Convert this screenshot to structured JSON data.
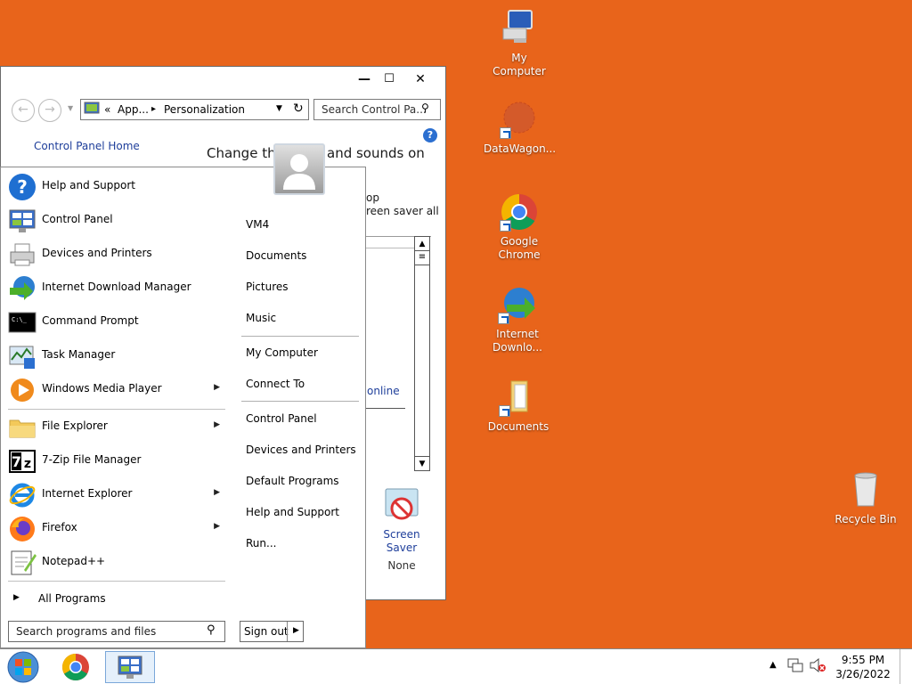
{
  "desktop": {
    "background": "#e8641b",
    "icons": [
      {
        "label": "My Computer",
        "icon": "computer-icon"
      },
      {
        "label": "DataWagon...",
        "icon": "datawagon-icon"
      },
      {
        "label": "Google Chrome",
        "icon": "chrome-icon"
      },
      {
        "label": "Internet Downlo...",
        "icon": "idm-icon"
      },
      {
        "label": "Documents",
        "icon": "folder-icon"
      },
      {
        "label": "Recycle Bin",
        "icon": "recycle-bin-icon"
      }
    ]
  },
  "window": {
    "minimize": "—",
    "maximize": "☐",
    "close": "✕",
    "breadcrumb_prefix": "«",
    "breadcrumb_app": "App...",
    "breadcrumb_sep": "▸",
    "breadcrumb_current": "Personalization",
    "search_placeholder": "Search Control Pa...",
    "control_panel_home": "Control Panel Home",
    "heading_left": "Change the",
    "heading_right": "and sounds on",
    "frag_op": "op",
    "frag_screensaver": "reen saver all",
    "frag_online": "online",
    "screen_saver_label_1": "Screen",
    "screen_saver_label_2": "Saver",
    "screen_saver_value": "None"
  },
  "start_menu": {
    "left_items": [
      {
        "label": "Help and Support",
        "icon": "help-icon",
        "arrow": false
      },
      {
        "label": "Control Panel",
        "icon": "control-panel-icon",
        "arrow": false
      },
      {
        "label": "Devices and Printers",
        "icon": "printer-icon",
        "arrow": false
      },
      {
        "label": "Internet Download Manager",
        "icon": "idm-icon",
        "arrow": false
      },
      {
        "label": "Command Prompt",
        "icon": "cmd-icon",
        "arrow": false
      },
      {
        "label": "Task Manager",
        "icon": "task-manager-icon",
        "arrow": false
      },
      {
        "label": "Windows Media Player",
        "icon": "media-player-icon",
        "arrow": true
      },
      {
        "label": "File Explorer",
        "icon": "file-explorer-icon",
        "arrow": true
      },
      {
        "label": "7-Zip File Manager",
        "icon": "7zip-icon",
        "arrow": false
      },
      {
        "label": "Internet Explorer",
        "icon": "ie-icon",
        "arrow": true
      },
      {
        "label": "Firefox",
        "icon": "firefox-icon",
        "arrow": true
      },
      {
        "label": "Notepad++",
        "icon": "notepadpp-icon",
        "arrow": false
      }
    ],
    "all_programs": "All Programs",
    "search_placeholder": "Search programs and files",
    "right_items": [
      "VM4",
      "Documents",
      "Pictures",
      "Music",
      "My Computer",
      "Connect To",
      "Control Panel",
      "Devices and Printers",
      "Default Programs",
      "Help and Support",
      "Run..."
    ],
    "sign_out": "Sign out"
  },
  "taskbar": {
    "time": "9:55 PM",
    "date": "3/26/2022",
    "tray_arrow": "▲"
  }
}
